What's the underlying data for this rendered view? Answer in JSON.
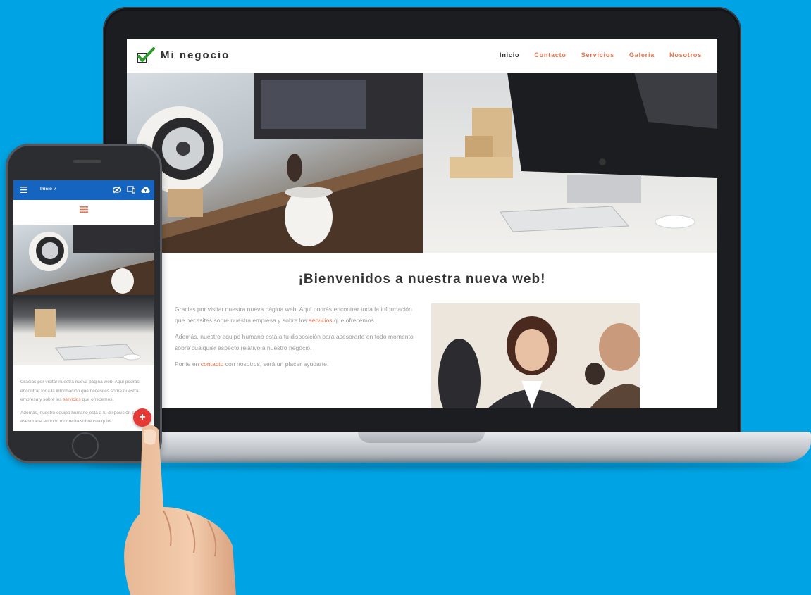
{
  "site": {
    "brand": "Mi negocio",
    "nav": [
      "Inicio",
      "Contacto",
      "Servicios",
      "Galeria",
      "Nosotros"
    ],
    "welcome_title": "¡Bienvenidos a nuestra nueva web!",
    "para1_a": "Gracias por visitar nuestra nueva página web. Aquí podrás encontrar toda la información que necesites sobre nuestra empresa y sobre los ",
    "para1_link": "servicios",
    "para1_b": " que ofrecemos.",
    "para2": "Además, nuestro equipo humano está a tu disposición para asesorarte en todo momento sobre cualquier aspecto relativo a nuestro negocio.",
    "para3_a": "Ponte en ",
    "para3_link": "contacto",
    "para3_b": " con nosotros, será un placer ayudarte."
  },
  "phone": {
    "page_select": "Inicio ˅",
    "text1_a": "Gracias por visitar nuestra nueva página web. Aquí podrás encontrar toda la información que necesites sobre nuestra empresa y sobre los ",
    "text1_link": "servicios",
    "text1_b": " que ofrecemos.",
    "text2": "Además, nuestro equipo humano está a tu disposición para asesorarte en todo momento sobre cualquier",
    "fab_label": "+"
  },
  "colors": {
    "background": "#00a4e4",
    "accent": "#e8704a",
    "app_bar": "#1565c0",
    "fab": "#e53935",
    "logo_check": "#2e9b2e"
  },
  "icons": {
    "logo": "check-icon",
    "phone_menu": "hamburger-icon",
    "phone_preview": "eye-off-icon",
    "phone_device": "devices-icon",
    "phone_publish": "cloud-upload-icon"
  }
}
